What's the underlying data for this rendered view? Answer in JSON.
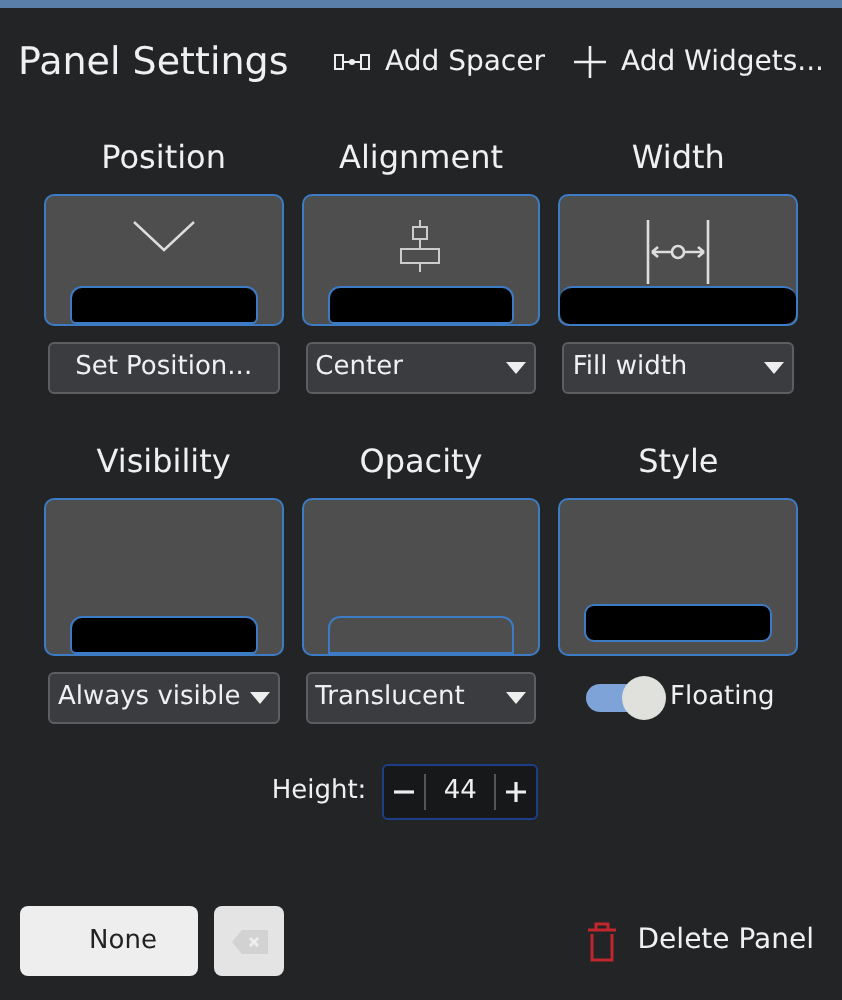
{
  "window": {
    "title": "Panel Settings"
  },
  "toolbar": [
    {
      "label": "Add Spacer"
    },
    {
      "label": "Add Widgets..."
    }
  ],
  "sections": [
    {
      "label": "Position",
      "preview": {
        "kind": "inset"
      },
      "control": {
        "kind": "button",
        "label": "Set Position..."
      }
    },
    {
      "label": "Alignment",
      "preview": {
        "kind": "inset"
      },
      "control": {
        "kind": "dropdown",
        "value": "Center"
      }
    },
    {
      "label": "Width",
      "preview": {
        "kind": "full"
      },
      "control": {
        "kind": "dropdown",
        "value": "Fill width"
      }
    },
    {
      "label": "Visibility",
      "preview": {
        "kind": "inset"
      },
      "control": {
        "kind": "dropdown",
        "value": "Always visible"
      }
    },
    {
      "label": "Opacity",
      "preview": {
        "kind": "outline"
      },
      "control": {
        "kind": "dropdown",
        "value": "Translucent"
      }
    },
    {
      "label": "Style",
      "preview": {
        "kind": "floating"
      },
      "control": {
        "kind": "toggle",
        "label": "Floating",
        "on": true
      }
    }
  ],
  "height": {
    "label": "Height:",
    "value": "44"
  },
  "footer": {
    "shortcut_button": "None",
    "delete_button": "Delete Panel"
  }
}
